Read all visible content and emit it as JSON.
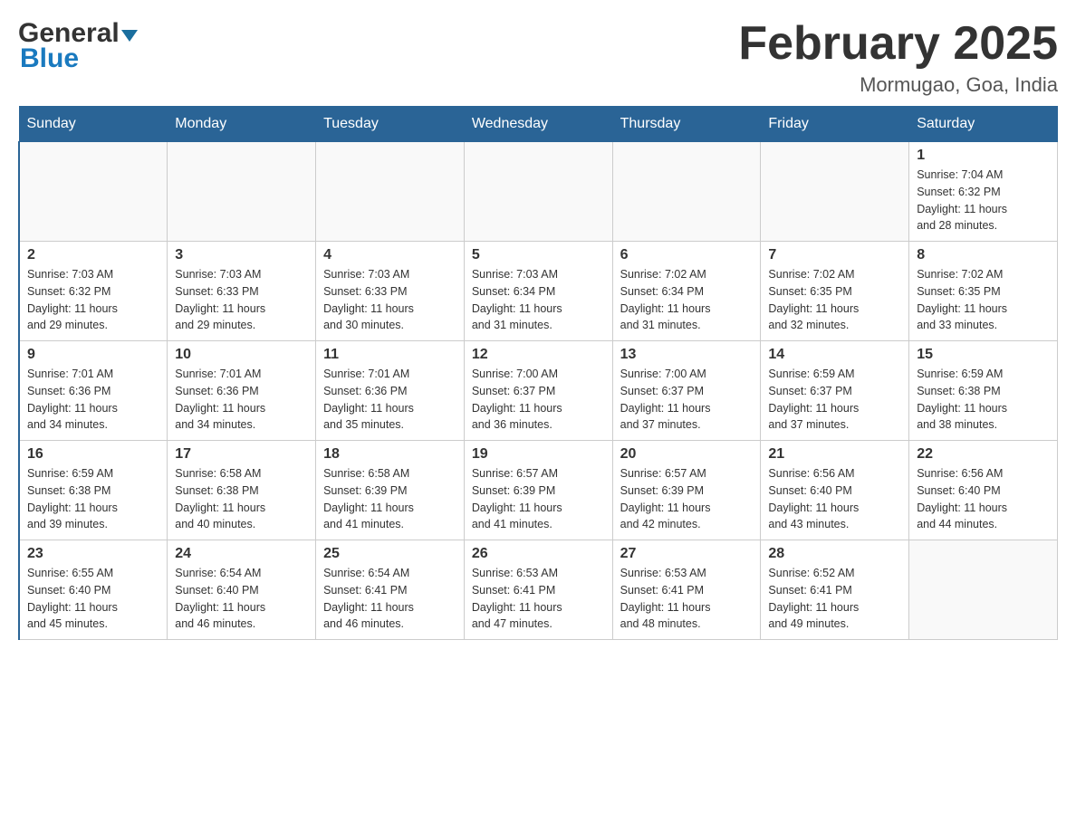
{
  "header": {
    "logo_general": "General",
    "logo_blue": "Blue",
    "month_title": "February 2025",
    "location": "Mormugao, Goa, India"
  },
  "weekdays": [
    "Sunday",
    "Monday",
    "Tuesday",
    "Wednesday",
    "Thursday",
    "Friday",
    "Saturday"
  ],
  "weeks": [
    [
      {
        "day": "",
        "info": ""
      },
      {
        "day": "",
        "info": ""
      },
      {
        "day": "",
        "info": ""
      },
      {
        "day": "",
        "info": ""
      },
      {
        "day": "",
        "info": ""
      },
      {
        "day": "",
        "info": ""
      },
      {
        "day": "1",
        "info": "Sunrise: 7:04 AM\nSunset: 6:32 PM\nDaylight: 11 hours\nand 28 minutes."
      }
    ],
    [
      {
        "day": "2",
        "info": "Sunrise: 7:03 AM\nSunset: 6:32 PM\nDaylight: 11 hours\nand 29 minutes."
      },
      {
        "day": "3",
        "info": "Sunrise: 7:03 AM\nSunset: 6:33 PM\nDaylight: 11 hours\nand 29 minutes."
      },
      {
        "day": "4",
        "info": "Sunrise: 7:03 AM\nSunset: 6:33 PM\nDaylight: 11 hours\nand 30 minutes."
      },
      {
        "day": "5",
        "info": "Sunrise: 7:03 AM\nSunset: 6:34 PM\nDaylight: 11 hours\nand 31 minutes."
      },
      {
        "day": "6",
        "info": "Sunrise: 7:02 AM\nSunset: 6:34 PM\nDaylight: 11 hours\nand 31 minutes."
      },
      {
        "day": "7",
        "info": "Sunrise: 7:02 AM\nSunset: 6:35 PM\nDaylight: 11 hours\nand 32 minutes."
      },
      {
        "day": "8",
        "info": "Sunrise: 7:02 AM\nSunset: 6:35 PM\nDaylight: 11 hours\nand 33 minutes."
      }
    ],
    [
      {
        "day": "9",
        "info": "Sunrise: 7:01 AM\nSunset: 6:36 PM\nDaylight: 11 hours\nand 34 minutes."
      },
      {
        "day": "10",
        "info": "Sunrise: 7:01 AM\nSunset: 6:36 PM\nDaylight: 11 hours\nand 34 minutes."
      },
      {
        "day": "11",
        "info": "Sunrise: 7:01 AM\nSunset: 6:36 PM\nDaylight: 11 hours\nand 35 minutes."
      },
      {
        "day": "12",
        "info": "Sunrise: 7:00 AM\nSunset: 6:37 PM\nDaylight: 11 hours\nand 36 minutes."
      },
      {
        "day": "13",
        "info": "Sunrise: 7:00 AM\nSunset: 6:37 PM\nDaylight: 11 hours\nand 37 minutes."
      },
      {
        "day": "14",
        "info": "Sunrise: 6:59 AM\nSunset: 6:37 PM\nDaylight: 11 hours\nand 37 minutes."
      },
      {
        "day": "15",
        "info": "Sunrise: 6:59 AM\nSunset: 6:38 PM\nDaylight: 11 hours\nand 38 minutes."
      }
    ],
    [
      {
        "day": "16",
        "info": "Sunrise: 6:59 AM\nSunset: 6:38 PM\nDaylight: 11 hours\nand 39 minutes."
      },
      {
        "day": "17",
        "info": "Sunrise: 6:58 AM\nSunset: 6:38 PM\nDaylight: 11 hours\nand 40 minutes."
      },
      {
        "day": "18",
        "info": "Sunrise: 6:58 AM\nSunset: 6:39 PM\nDaylight: 11 hours\nand 41 minutes."
      },
      {
        "day": "19",
        "info": "Sunrise: 6:57 AM\nSunset: 6:39 PM\nDaylight: 11 hours\nand 41 minutes."
      },
      {
        "day": "20",
        "info": "Sunrise: 6:57 AM\nSunset: 6:39 PM\nDaylight: 11 hours\nand 42 minutes."
      },
      {
        "day": "21",
        "info": "Sunrise: 6:56 AM\nSunset: 6:40 PM\nDaylight: 11 hours\nand 43 minutes."
      },
      {
        "day": "22",
        "info": "Sunrise: 6:56 AM\nSunset: 6:40 PM\nDaylight: 11 hours\nand 44 minutes."
      }
    ],
    [
      {
        "day": "23",
        "info": "Sunrise: 6:55 AM\nSunset: 6:40 PM\nDaylight: 11 hours\nand 45 minutes."
      },
      {
        "day": "24",
        "info": "Sunrise: 6:54 AM\nSunset: 6:40 PM\nDaylight: 11 hours\nand 46 minutes."
      },
      {
        "day": "25",
        "info": "Sunrise: 6:54 AM\nSunset: 6:41 PM\nDaylight: 11 hours\nand 46 minutes."
      },
      {
        "day": "26",
        "info": "Sunrise: 6:53 AM\nSunset: 6:41 PM\nDaylight: 11 hours\nand 47 minutes."
      },
      {
        "day": "27",
        "info": "Sunrise: 6:53 AM\nSunset: 6:41 PM\nDaylight: 11 hours\nand 48 minutes."
      },
      {
        "day": "28",
        "info": "Sunrise: 6:52 AM\nSunset: 6:41 PM\nDaylight: 11 hours\nand 49 minutes."
      },
      {
        "day": "",
        "info": ""
      }
    ]
  ]
}
